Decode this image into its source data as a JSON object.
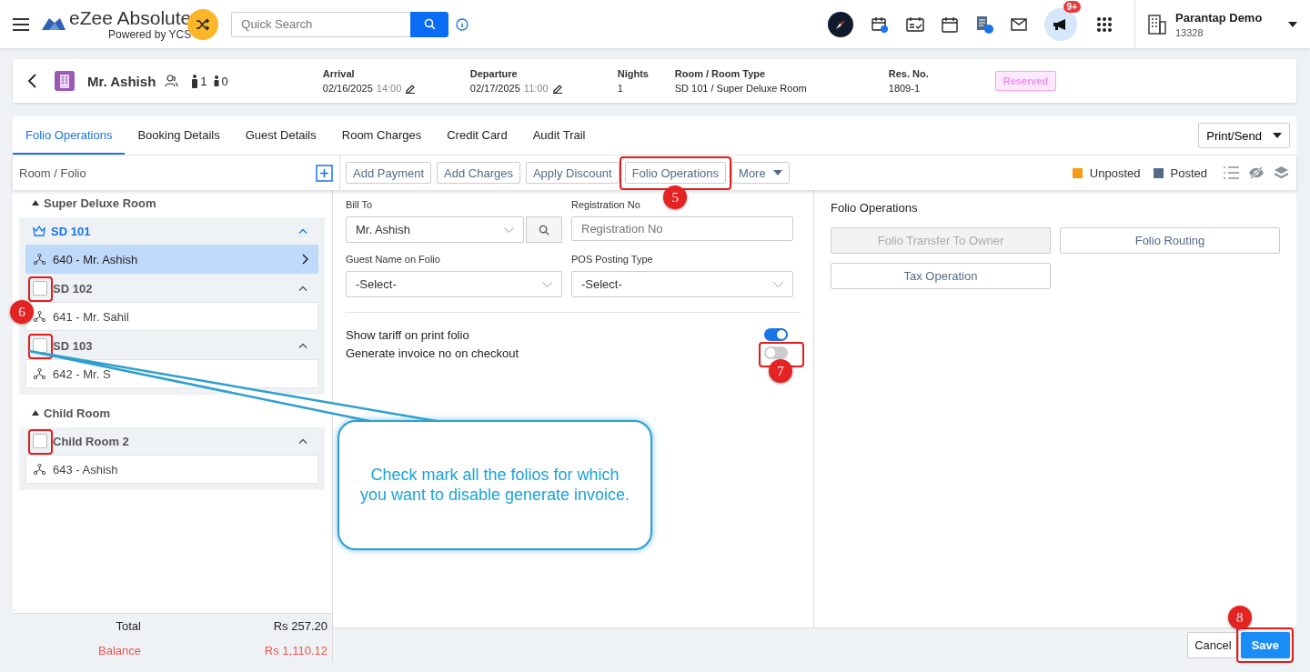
{
  "header": {
    "brand": {
      "name": "eZee Absolute",
      "tagline": "Powered by YCS"
    },
    "search": {
      "placeholder": "Quick Search"
    },
    "notification_badge": "9+",
    "property": {
      "name": "Parantap Demo",
      "code": "13328"
    }
  },
  "reservation": {
    "guest": "Mr. Ashish",
    "adults": "1",
    "children": "0",
    "status": "Reserved",
    "fields": [
      {
        "label": "Arrival",
        "value": "02/16/2025",
        "time": "14:00"
      },
      {
        "label": "Departure",
        "value": "02/17/2025",
        "time": "11:00"
      },
      {
        "label": "Nights",
        "value": "1"
      },
      {
        "label": "Room / Room Type",
        "value": "SD 101 / Super Deluxe Room"
      },
      {
        "label": "Res. No.",
        "value": "1809-1"
      }
    ]
  },
  "tabs": [
    {
      "label": "Folio Operations",
      "selected": true
    },
    {
      "label": "Booking Details",
      "selected": false
    },
    {
      "label": "Guest Details",
      "selected": false
    },
    {
      "label": "Room Charges",
      "selected": false
    },
    {
      "label": "Credit Card",
      "selected": false
    },
    {
      "label": "Audit Trail",
      "selected": false
    }
  ],
  "print_button": "Print/Send",
  "toolbar": {
    "buttons": [
      {
        "label": "Add Payment",
        "kind": "button",
        "highlighted": false
      },
      {
        "label": "Add Charges",
        "kind": "button",
        "highlighted": false
      },
      {
        "label": "Apply Discount",
        "kind": "button",
        "highlighted": false
      },
      {
        "label": "Folio Operations",
        "kind": "button",
        "highlighted": true,
        "marker": "5"
      },
      {
        "label": "More",
        "kind": "dropdown",
        "highlighted": false
      }
    ],
    "legend": [
      {
        "label": "Unposted",
        "color": "#f39c12"
      },
      {
        "label": "Posted",
        "color": "#546a87"
      }
    ]
  },
  "folio_panel": {
    "title": "Room / Folio",
    "groups": [
      {
        "name": "Super Deluxe Room",
        "expanded": true,
        "rooms": [
          {
            "name": "SD 101",
            "selected": true,
            "expanded": true,
            "folios": [
              {
                "label": "640 - Mr. Ashish",
                "selected": true
              }
            ]
          },
          {
            "name": "SD 102",
            "selected": false,
            "checked": false,
            "expanded": true,
            "highlighted": true,
            "marker": "6",
            "folios": [
              {
                "label": "641 - Mr. Sahil",
                "selected": false
              }
            ]
          },
          {
            "name": "SD 103",
            "selected": false,
            "checked": false,
            "expanded": true,
            "highlighted": true,
            "folios": [
              {
                "label": "642 - Mr. S",
                "selected": false
              }
            ]
          }
        ]
      },
      {
        "name": "Child Room",
        "expanded": true,
        "rooms": [
          {
            "name": "Child Room 2",
            "selected": false,
            "checked": false,
            "expanded": true,
            "highlighted": true,
            "folios": [
              {
                "label": "643 - Ashish",
                "selected": false
              }
            ]
          }
        ]
      }
    ],
    "total_label": "Total",
    "total": "Rs 257.20",
    "balance_label": "Balance",
    "balance": "Rs 1,110.12"
  },
  "form": {
    "bill_to": {
      "label": "Bill To",
      "value": "Mr. Ashish"
    },
    "registration": {
      "label": "Registration No",
      "placeholder": "Registration No"
    },
    "guest_name": {
      "label": "Guest Name on Folio",
      "value": "-Select-"
    },
    "pos": {
      "label": "POS Posting Type",
      "value": "-Select-"
    },
    "toggles": [
      {
        "label": "Show tariff on print folio",
        "on": true,
        "highlighted": false
      },
      {
        "label": "Generate invoice no on checkout",
        "on": false,
        "highlighted": true,
        "marker": "7"
      }
    ]
  },
  "operations": {
    "title": "Folio Operations",
    "buttons": [
      {
        "label": "Folio Transfer To Owner",
        "disabled": true
      },
      {
        "label": "Folio Routing",
        "disabled": false
      },
      {
        "label": "Tax Operation",
        "disabled": false
      }
    ]
  },
  "footer": {
    "buttons": [
      {
        "label": "Cancel",
        "kind": "secondary",
        "highlighted": false
      },
      {
        "label": "Save",
        "kind": "primary",
        "highlighted": true,
        "marker": "8"
      }
    ]
  },
  "callout": {
    "text": "Check mark all the folios for which you want to disable generate invoice."
  }
}
